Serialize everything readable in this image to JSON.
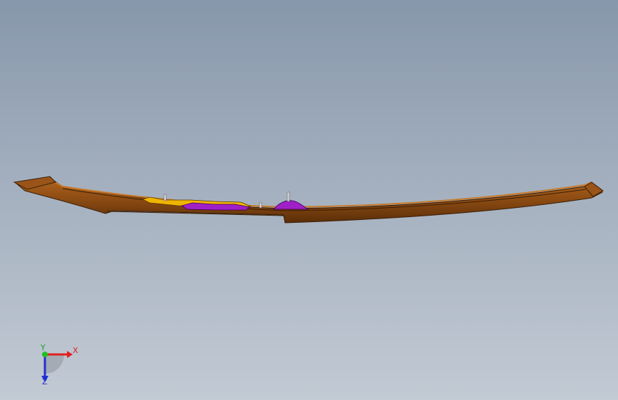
{
  "viewport": {
    "background_top": "#8797ab",
    "background_bottom": "#c2cad4"
  },
  "model": {
    "part_color": "#8a4a12",
    "edge_color": "#3a1e06",
    "highlight_yellow": "#f0b400",
    "highlight_purple": "#a020c8"
  },
  "triad": {
    "x_label": "X",
    "y_label": "Y",
    "z_label": "Z",
    "x_color": "#e02020",
    "y_color": "#20c020",
    "z_color": "#2030d0"
  }
}
